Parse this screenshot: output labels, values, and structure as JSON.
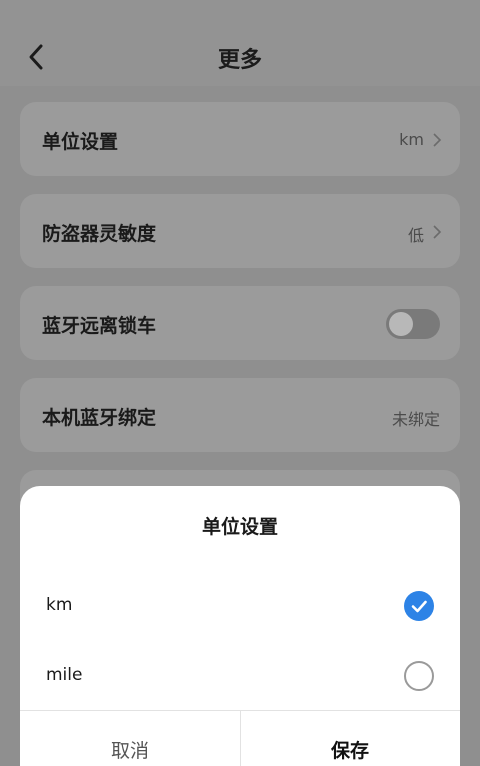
{
  "header": {
    "title": "更多"
  },
  "settings": [
    {
      "label": "单位设置",
      "value": "km"
    },
    {
      "label": "防盗器灵敏度",
      "value": "低"
    },
    {
      "label": "蓝牙远离锁车",
      "toggle_on": false
    },
    {
      "label": "本机蓝牙绑定",
      "value": "未绑定"
    }
  ],
  "sheet": {
    "title": "单位设置",
    "options": [
      {
        "label": "km",
        "selected": true
      },
      {
        "label": "mile",
        "selected": false
      }
    ],
    "cancel_label": "取消",
    "save_label": "保存"
  },
  "colors": {
    "accent": "#2d83e6"
  }
}
